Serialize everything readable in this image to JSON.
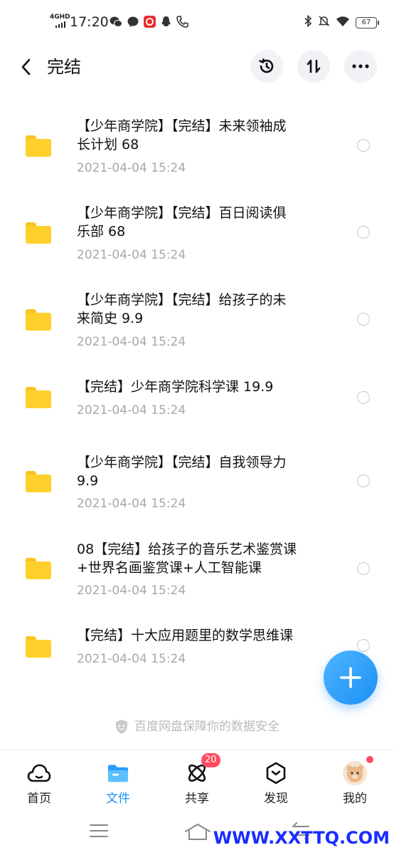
{
  "status_bar": {
    "network": "4GHD",
    "time": "17:20",
    "battery": "67"
  },
  "header": {
    "title": "完结"
  },
  "files": [
    {
      "name_line1": "【少年商学院】【完结】未来领袖成",
      "name_line2": "长计划 68",
      "date": "2021-04-04  15:24"
    },
    {
      "name_line1": "【少年商学院】【完结】百日阅读俱",
      "name_line2": "乐部 68",
      "date": "2021-04-04  15:24"
    },
    {
      "name_line1": "【少年商学院】【完结】给孩子的未",
      "name_line2": "来简史 9.9",
      "date": "2021-04-04  15:24"
    },
    {
      "name_line1": "【完结】少年商学院科学课 19.9",
      "name_line2": "",
      "date": "2021-04-04  15:24"
    },
    {
      "name_line1": "【少年商学院】【完结】自我领导力",
      "name_line2": "9.9",
      "date": "2021-04-04  15:24"
    },
    {
      "name_line1": "08【完结】给孩子的音乐艺术鉴赏课",
      "name_line2": "+世界名画鉴赏课+人工智能课",
      "date": "2021-04-04  15:24"
    },
    {
      "name_line1": "【完结】十大应用题里的数学思维课",
      "name_line2": "",
      "date": "2021-04-04  15:24"
    }
  ],
  "security_note": "百度网盘保障你的数据安全",
  "tabs": [
    {
      "label": "首页",
      "icon": "cloud-icon"
    },
    {
      "label": "文件",
      "icon": "folder-icon",
      "active": true
    },
    {
      "label": "共享",
      "icon": "atom-icon",
      "badge": "20"
    },
    {
      "label": "发现",
      "icon": "discover-icon"
    },
    {
      "label": "我的",
      "icon": "avatar"
    }
  ],
  "watermark": "WWW.XXTTQ.COM",
  "colors": {
    "accent": "#1a8ff5",
    "folder": "#ffd02b",
    "badge": "#ff4d5e",
    "date_text": "#a6a8ad"
  }
}
